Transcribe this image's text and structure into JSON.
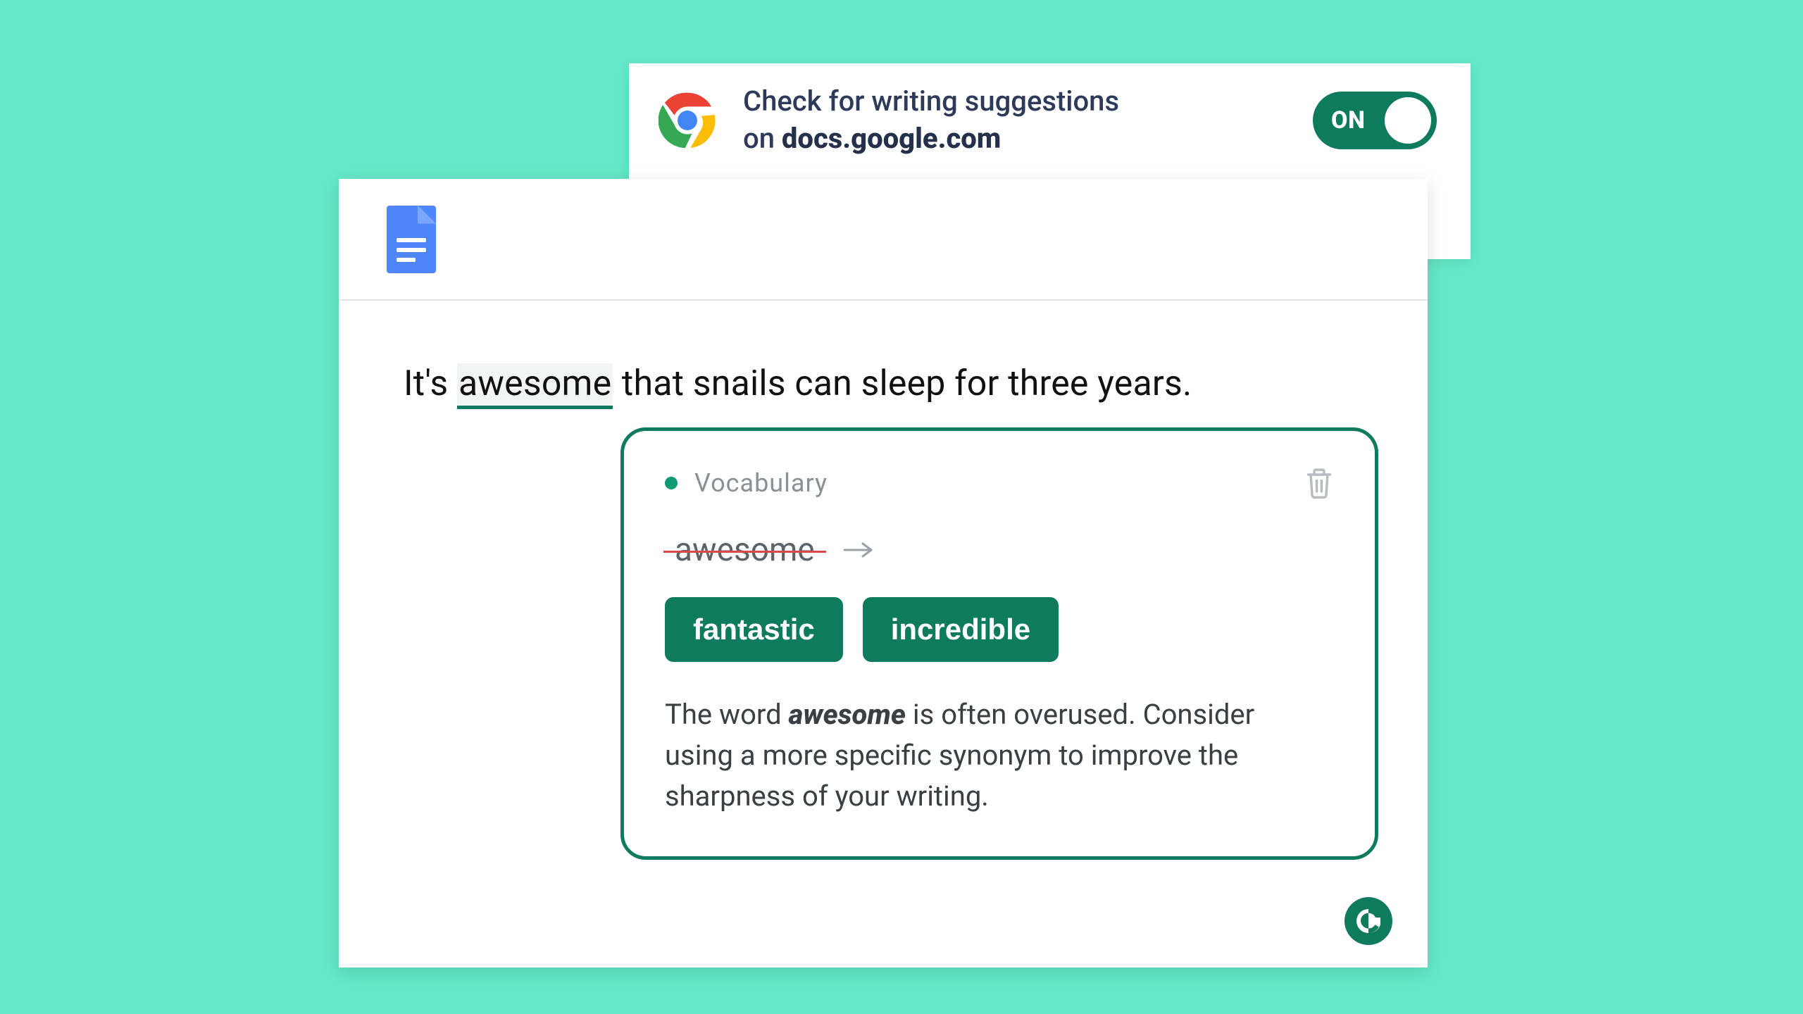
{
  "extension": {
    "line1": "Check for writing suggestions",
    "line2_prefix": "on ",
    "domain": "docs.google.com",
    "toggle_label": "ON",
    "toggle_state": true
  },
  "document": {
    "sentence_before": "It's ",
    "flagged_word": "awesome",
    "sentence_after": " that snails can sleep for three years."
  },
  "suggestion": {
    "tag": "Vocabulary",
    "strike_word": "awesome",
    "replacements": [
      "fantastic",
      "incredible"
    ],
    "explain_pre": "The word ",
    "explain_word": "awesome",
    "explain_post": " is often overused. Consider using a more specific synonym to improve the sharpness of your writing."
  },
  "colors": {
    "brand_teal": "#0e7a5e",
    "bg_mint": "#64e8c7"
  }
}
